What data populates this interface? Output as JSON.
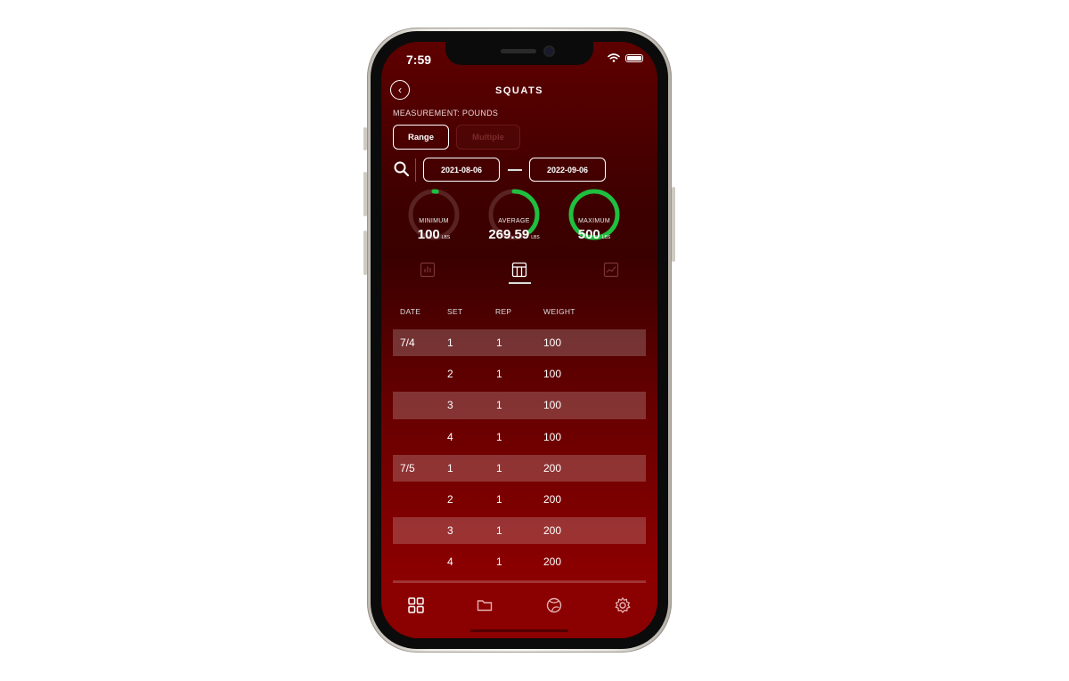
{
  "status_bar": {
    "time": "7:59"
  },
  "header": {
    "title": "SQUATS",
    "measurement": "MEASUREMENT: POUNDS"
  },
  "mode_toggle": {
    "selected": "Range",
    "options": [
      "Range",
      "Multiple"
    ]
  },
  "date_range": {
    "start": "2021-08-06",
    "end": "2022-09-06"
  },
  "stats": [
    {
      "label": "MINIMUM",
      "value": "100",
      "unit": "LBS",
      "fraction": 0.02
    },
    {
      "label": "AVERAGE",
      "value": "269.59",
      "unit": "LBS",
      "fraction": 0.38
    },
    {
      "label": "MAXIMUM",
      "value": "500",
      "unit": "LBS",
      "fraction": 1.0
    }
  ],
  "view_options": {
    "selected": "table-view",
    "options": [
      "bar-chart-icon",
      "table-view-icon",
      "line-chart-icon"
    ]
  },
  "table": {
    "headers": [
      "DATE",
      "SET",
      "REP",
      "WEIGHT"
    ],
    "rows": [
      {
        "date": "7/4",
        "set": "1",
        "rep": "1",
        "weight": "100"
      },
      {
        "date": "",
        "set": "2",
        "rep": "1",
        "weight": "100"
      },
      {
        "date": "",
        "set": "3",
        "rep": "1",
        "weight": "100"
      },
      {
        "date": "",
        "set": "4",
        "rep": "1",
        "weight": "100"
      },
      {
        "date": "7/5",
        "set": "1",
        "rep": "1",
        "weight": "200"
      },
      {
        "date": "",
        "set": "2",
        "rep": "1",
        "weight": "200"
      },
      {
        "date": "",
        "set": "3",
        "rep": "1",
        "weight": "200"
      },
      {
        "date": "",
        "set": "4",
        "rep": "1",
        "weight": "200"
      },
      {
        "date": "",
        "set": "",
        "rep": "",
        "weight": ""
      }
    ]
  },
  "tab_bar": [
    "grid-icon",
    "folder-icon",
    "ball-icon",
    "settings-icon"
  ],
  "colors": {
    "accent_green": "#1fbf3f",
    "track": "#5a2323",
    "background": "#5e0000",
    "tab_bar": "#8b0000"
  }
}
